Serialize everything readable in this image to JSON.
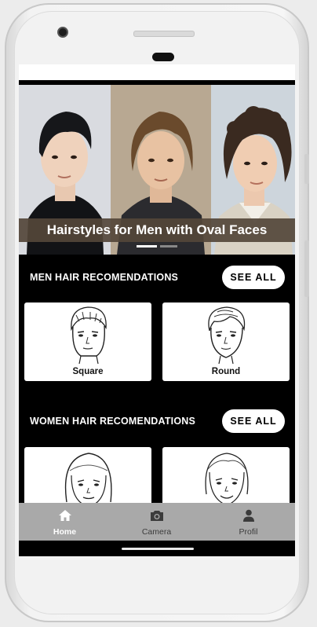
{
  "hero": {
    "caption": "Hairstyles for Men with Oval Faces",
    "carousel": {
      "active_index": 0,
      "count": 2
    }
  },
  "men_section": {
    "title": "MEN HAIR RECOMENDATIONS",
    "see_all_label": "SEE ALL",
    "cards": [
      {
        "label": "Square"
      },
      {
        "label": "Round"
      }
    ]
  },
  "women_section": {
    "title": "WOMEN HAIR RECOMENDATIONS",
    "see_all_label": "SEE ALL",
    "cards": [
      {
        "label": ""
      },
      {
        "label": ""
      }
    ]
  },
  "bottom_nav": {
    "items": [
      {
        "label": "Home",
        "icon": "home-icon",
        "active": true
      },
      {
        "label": "Camera",
        "icon": "camera-icon",
        "active": false
      },
      {
        "label": "Profil",
        "icon": "person-icon",
        "active": false
      }
    ]
  },
  "colors": {
    "screen_bg": "#000000",
    "caption_bg": "#54463a",
    "nav_bg": "#a9a9a9",
    "button_bg": "#ffffff"
  }
}
